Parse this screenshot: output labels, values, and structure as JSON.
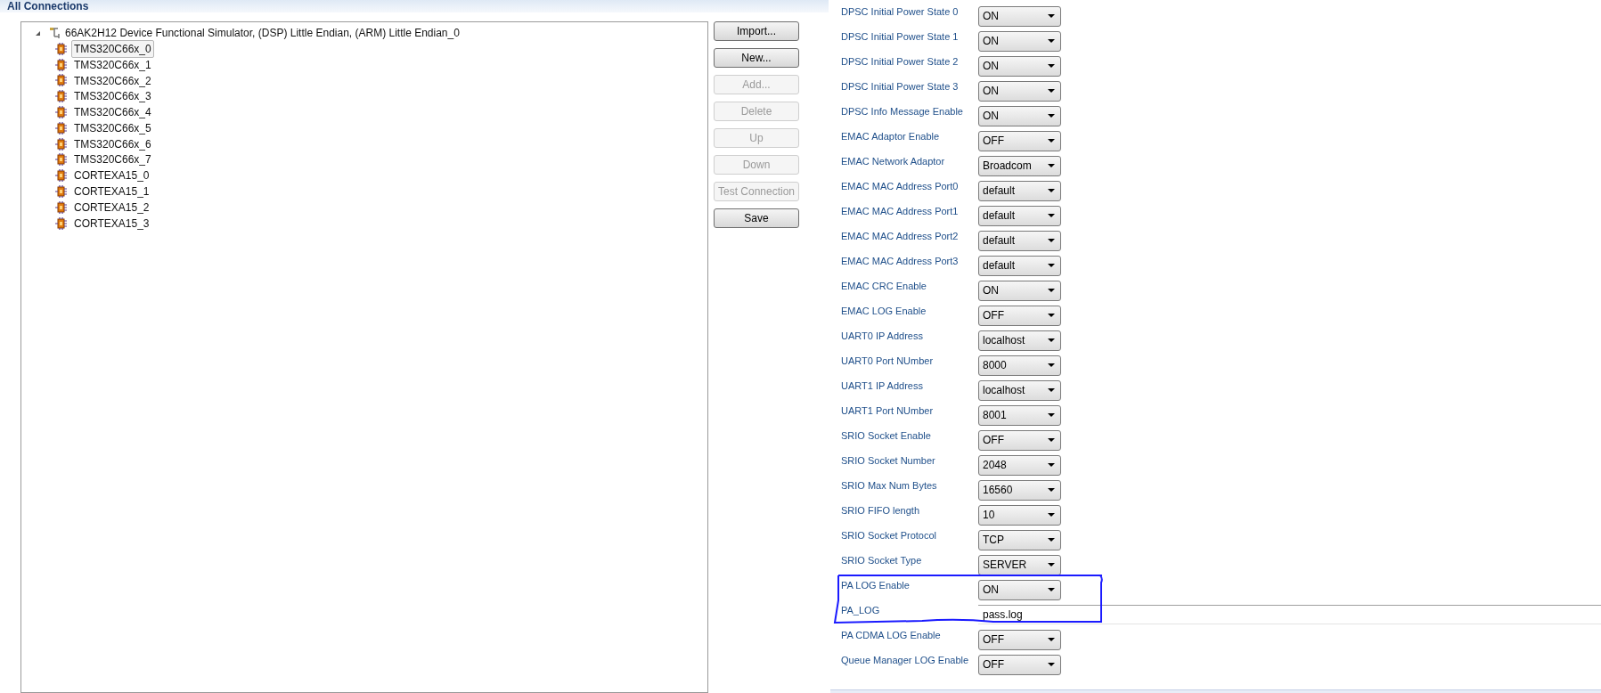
{
  "header": {
    "title": "All Connections"
  },
  "tree": {
    "label": "66AK2H12 Device Functional Simulator, (DSP) Little Endian, (ARM) Little Endian_0",
    "expanded": true,
    "children": [
      {
        "label": "TMS320C66x_0",
        "selected": true
      },
      {
        "label": "TMS320C66x_1",
        "selected": false
      },
      {
        "label": "TMS320C66x_2",
        "selected": false
      },
      {
        "label": "TMS320C66x_3",
        "selected": false
      },
      {
        "label": "TMS320C66x_4",
        "selected": false
      },
      {
        "label": "TMS320C66x_5",
        "selected": false
      },
      {
        "label": "TMS320C66x_6",
        "selected": false
      },
      {
        "label": "TMS320C66x_7",
        "selected": false
      },
      {
        "label": "CORTEXA15_0",
        "selected": false
      },
      {
        "label": "CORTEXA15_1",
        "selected": false
      },
      {
        "label": "CORTEXA15_2",
        "selected": false
      },
      {
        "label": "CORTEXA15_3",
        "selected": false
      }
    ]
  },
  "buttons": [
    {
      "label": "Import...",
      "disabled": false
    },
    {
      "label": "New...",
      "disabled": false
    },
    {
      "label": "Add...",
      "disabled": true
    },
    {
      "label": "Delete",
      "disabled": true
    },
    {
      "label": "Up",
      "disabled": true
    },
    {
      "label": "Down",
      "disabled": true
    },
    {
      "label": "Test Connection",
      "disabled": true
    },
    {
      "label": "Save",
      "disabled": false
    }
  ],
  "properties": [
    {
      "label": "DPSC Initial Power State 0",
      "kind": "dropdown",
      "value": "ON"
    },
    {
      "label": "DPSC Initial Power State 1",
      "kind": "dropdown",
      "value": "ON"
    },
    {
      "label": "DPSC Initial Power State 2",
      "kind": "dropdown",
      "value": "ON"
    },
    {
      "label": "DPSC Initial Power State 3",
      "kind": "dropdown",
      "value": "ON"
    },
    {
      "label": "DPSC Info Message Enable",
      "kind": "dropdown",
      "value": "ON"
    },
    {
      "label": "EMAC Adaptor Enable",
      "kind": "dropdown",
      "value": "OFF"
    },
    {
      "label": "EMAC Network Adaptor",
      "kind": "dropdown",
      "value": "Broadcom"
    },
    {
      "label": "EMAC MAC Address Port0",
      "kind": "dropdown",
      "value": "default"
    },
    {
      "label": "EMAC MAC Address Port1",
      "kind": "dropdown",
      "value": "default"
    },
    {
      "label": "EMAC MAC Address Port2",
      "kind": "dropdown",
      "value": "default"
    },
    {
      "label": "EMAC MAC Address Port3",
      "kind": "dropdown",
      "value": "default"
    },
    {
      "label": "EMAC CRC Enable",
      "kind": "dropdown",
      "value": "ON"
    },
    {
      "label": "EMAC LOG Enable",
      "kind": "dropdown",
      "value": "OFF"
    },
    {
      "label": "UART0 IP Address",
      "kind": "dropdown",
      "value": "localhost"
    },
    {
      "label": "UART0 Port NUmber",
      "kind": "dropdown",
      "value": "8000"
    },
    {
      "label": "UART1 IP Address",
      "kind": "dropdown",
      "value": "localhost"
    },
    {
      "label": "UART1 Port NUmber",
      "kind": "dropdown",
      "value": "8001"
    },
    {
      "label": "SRIO Socket Enable",
      "kind": "dropdown",
      "value": "OFF"
    },
    {
      "label": "SRIO Socket Number",
      "kind": "dropdown",
      "value": "2048"
    },
    {
      "label": "SRIO Max Num Bytes",
      "kind": "dropdown",
      "value": "16560"
    },
    {
      "label": "SRIO FIFO length",
      "kind": "dropdown",
      "value": "10"
    },
    {
      "label": "SRIO Socket Protocol",
      "kind": "dropdown",
      "value": "TCP"
    },
    {
      "label": "SRIO Socket Type",
      "kind": "dropdown",
      "value": "SERVER"
    },
    {
      "label": "PA LOG Enable",
      "kind": "dropdown",
      "value": "ON"
    },
    {
      "label": "PA_LOG",
      "kind": "text",
      "value": "pass.log"
    },
    {
      "label": "PA CDMA LOG Enable",
      "kind": "dropdown",
      "value": "OFF"
    },
    {
      "label": "Queue Manager LOG Enable",
      "kind": "dropdown",
      "value": "OFF"
    }
  ]
}
